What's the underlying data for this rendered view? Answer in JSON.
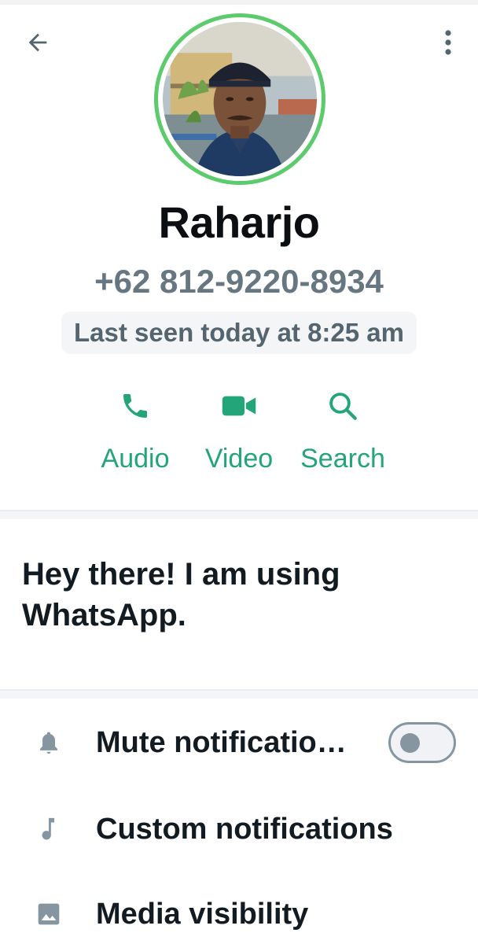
{
  "contact": {
    "name": "Raharjo",
    "phone": "+62 812-9220-8934",
    "last_seen": "Last seen today at 8:25 am",
    "about": "Hey there! I am using WhatsApp."
  },
  "actions": [
    {
      "label": "Audio",
      "icon": "phone-icon"
    },
    {
      "label": "Video",
      "icon": "video-icon"
    },
    {
      "label": "Search",
      "icon": "search-icon"
    }
  ],
  "settings": [
    {
      "label": "Mute notificatio…",
      "icon": "bell-icon",
      "toggle": false
    },
    {
      "label": "Custom notifications",
      "icon": "music-note-icon"
    },
    {
      "label": "Media visibility",
      "icon": "image-icon"
    }
  ],
  "colors": {
    "accent": "#23a579",
    "ring": "#5ccb6c",
    "muted_text": "#667781",
    "toggle_off": "#8696a0"
  }
}
